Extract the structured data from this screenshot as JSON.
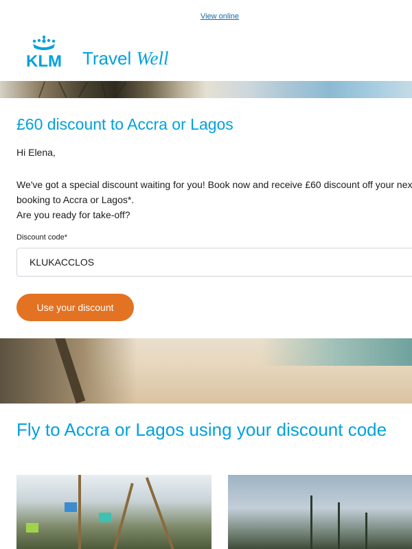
{
  "header": {
    "view_online": "View online",
    "logo_text": "KLM",
    "tagline_main": "Travel",
    "tagline_italic": "Well"
  },
  "offer": {
    "title": "£60 discount to Accra or Lagos",
    "greeting": "Hi Elena,",
    "body_line1": "We've got a special discount waiting for you! Book now and receive £60 discount off your next",
    "body_line2": "booking to Accra or Lagos*.",
    "body_line3": "Are you ready for take-off?",
    "code_label": "Discount code*",
    "code_value": "KLUKACCLOS",
    "cta_label": "Use your discount"
  },
  "section2": {
    "title": "Fly to Accra or Lagos using your discount code"
  },
  "colors": {
    "brand_blue": "#00a1de",
    "cta_orange": "#e37222",
    "link_blue": "#0b6aa8"
  }
}
